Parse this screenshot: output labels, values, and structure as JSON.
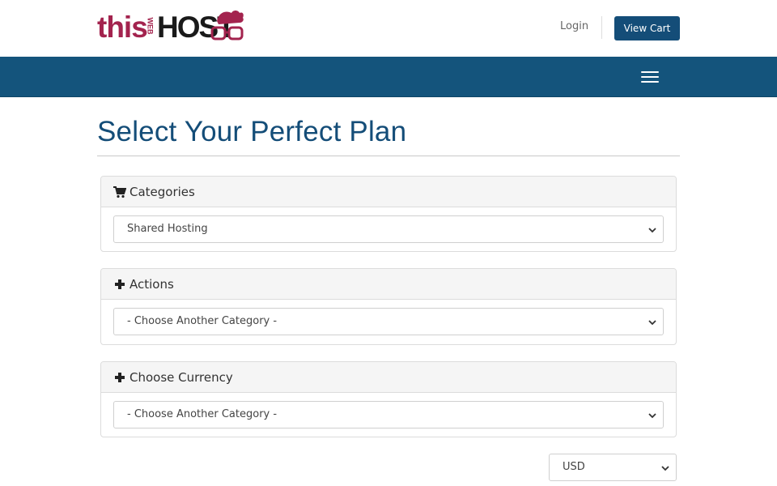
{
  "header": {
    "logo": {
      "part1": "this",
      "part2": "WEB",
      "part3": "HOST",
      "colors": {
        "accent": "#a3234e",
        "dark": "#1a1a1a"
      }
    },
    "login_label": "Login",
    "view_cart_label": "View Cart"
  },
  "navbar": {
    "color": "#14547c",
    "menu_icon": "hamburger-icon"
  },
  "page": {
    "title": "Select Your Perfect Plan"
  },
  "panels": [
    {
      "title": "Categories",
      "icon": "shopping-cart-icon",
      "select_value": "Shared Hosting"
    },
    {
      "title": "Actions",
      "icon": "plus-icon",
      "select_value": "- Choose Another Category -"
    },
    {
      "title": "Choose Currency",
      "icon": "plus-icon",
      "select_value": "- Choose Another Category -"
    }
  ],
  "currency": {
    "selected": "USD"
  },
  "colors": {
    "brand": "#144d78",
    "panel_header_bg": "#f5f5f5",
    "border": "#dcdcdc"
  }
}
